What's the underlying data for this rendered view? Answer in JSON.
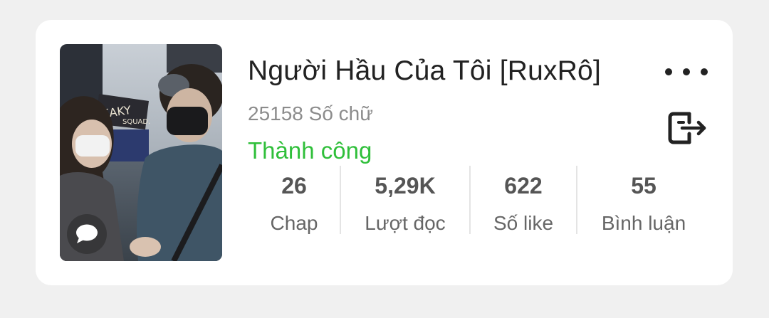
{
  "story": {
    "title": "Người Hầu Của Tôi [RuxRô]",
    "word_count": "25158 Số chữ",
    "status": "Thành công",
    "status_color": "#2fbf3a"
  },
  "stats": [
    {
      "value": "26",
      "label": "Chap"
    },
    {
      "value": "5,29K",
      "label": "Lượt đọc"
    },
    {
      "value": "622",
      "label": "Số like"
    },
    {
      "value": "55",
      "label": "Bình luận"
    }
  ],
  "icons": {
    "more": "more-horizontal-icon",
    "exit": "exit-icon",
    "comment": "comment-bubble-icon"
  }
}
